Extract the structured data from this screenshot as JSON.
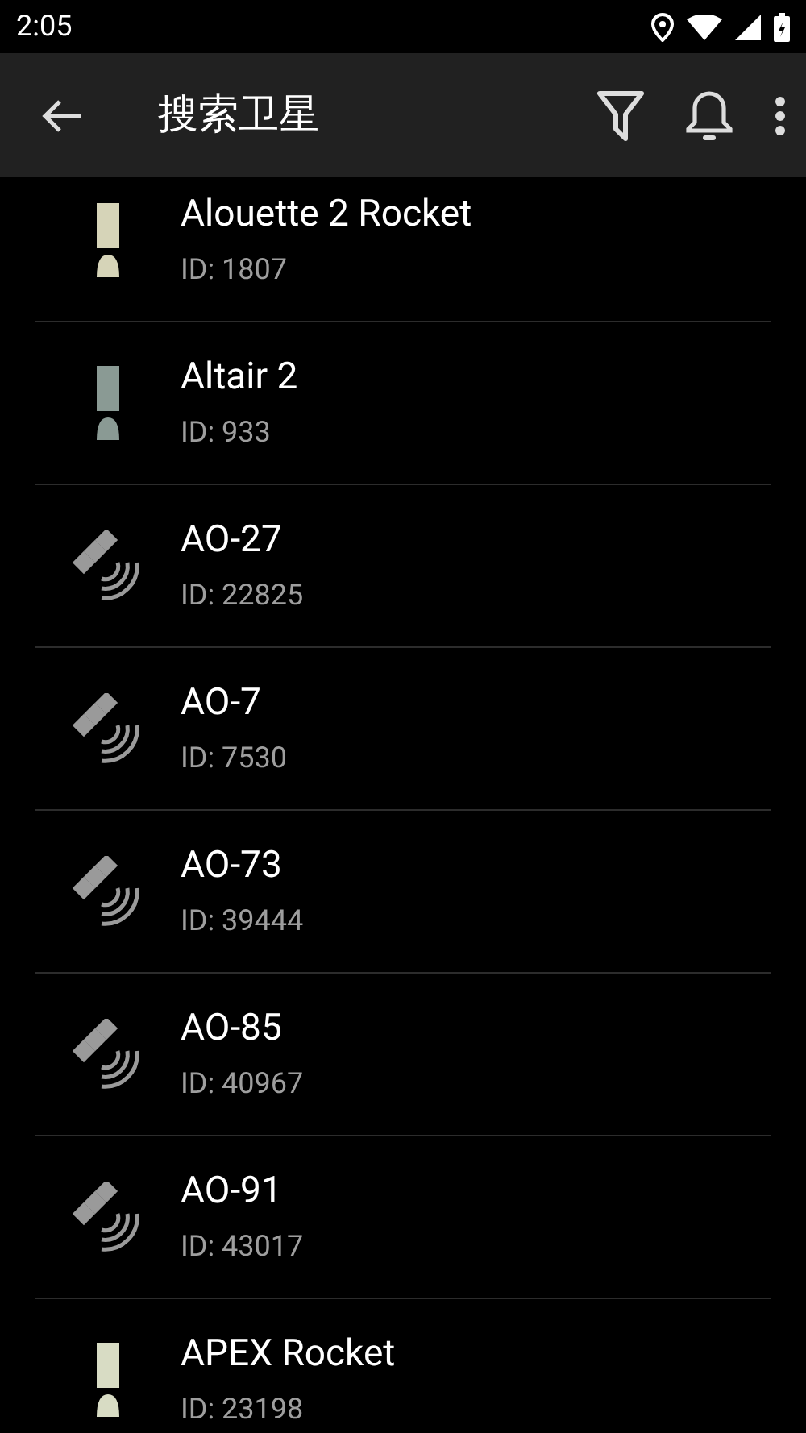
{
  "status_bar": {
    "time": "2:05"
  },
  "app_bar": {
    "title": "搜索卫星"
  },
  "satellites": [
    {
      "kind": "rocket",
      "color": "#d6d4b8",
      "name": "Alouette 2 Rocket",
      "id": "ID: 1807"
    },
    {
      "kind": "rocket",
      "color": "#8a9a94",
      "name": "Altair 2",
      "id": "ID: 933"
    },
    {
      "kind": "satellite",
      "name": "AO-27",
      "id": "ID: 22825"
    },
    {
      "kind": "satellite",
      "name": "AO-7",
      "id": "ID: 7530"
    },
    {
      "kind": "satellite",
      "name": "AO-73",
      "id": "ID: 39444"
    },
    {
      "kind": "satellite",
      "name": "AO-85",
      "id": "ID: 40967"
    },
    {
      "kind": "satellite",
      "name": "AO-91",
      "id": "ID: 43017"
    },
    {
      "kind": "rocket",
      "color": "#d8dcc4",
      "name": "APEX Rocket",
      "id": "ID: 23198"
    }
  ]
}
